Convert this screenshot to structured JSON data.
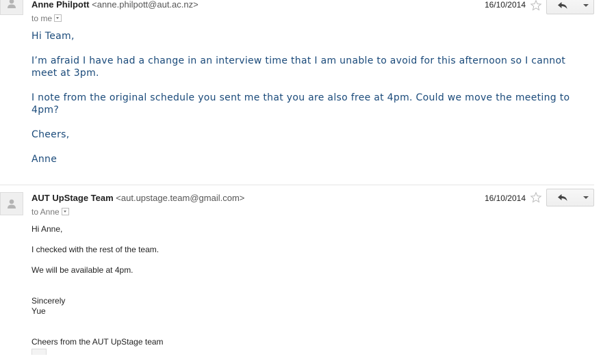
{
  "messages": [
    {
      "sender_name": "Anne Philpott",
      "sender_email": "<anne.philpott@aut.ac.nz>",
      "to_label": "to me",
      "date": "16/10/2014",
      "body": [
        "Hi Team,",
        "I’m afraid I have had a change in an interview time that I am unable to avoid for this afternoon so I cannot meet at 3pm.",
        "I note from the original schedule you sent me that you are also free at 4pm. Could we move the meeting to 4pm?",
        "Cheers,",
        "Anne"
      ]
    },
    {
      "sender_name": "AUT UpStage Team",
      "sender_email": "<aut.upstage.team@gmail.com>",
      "to_label": "to Anne",
      "date": "16/10/2014",
      "body": [
        "Hi Anne,",
        "I checked with the rest of the team.",
        "We will be available at 4pm.",
        "Sincerely",
        "Yue",
        "Cheers from the AUT UpStage team"
      ]
    }
  ],
  "icons": {
    "avatar": "default-person-icon",
    "star": "star-outline-icon",
    "reply": "reply-arrow-icon",
    "more": "dropdown-arrow-icon"
  },
  "colors": {
    "body_text_blue": "#1a4a7a",
    "button_border": "#d3d3d3"
  }
}
